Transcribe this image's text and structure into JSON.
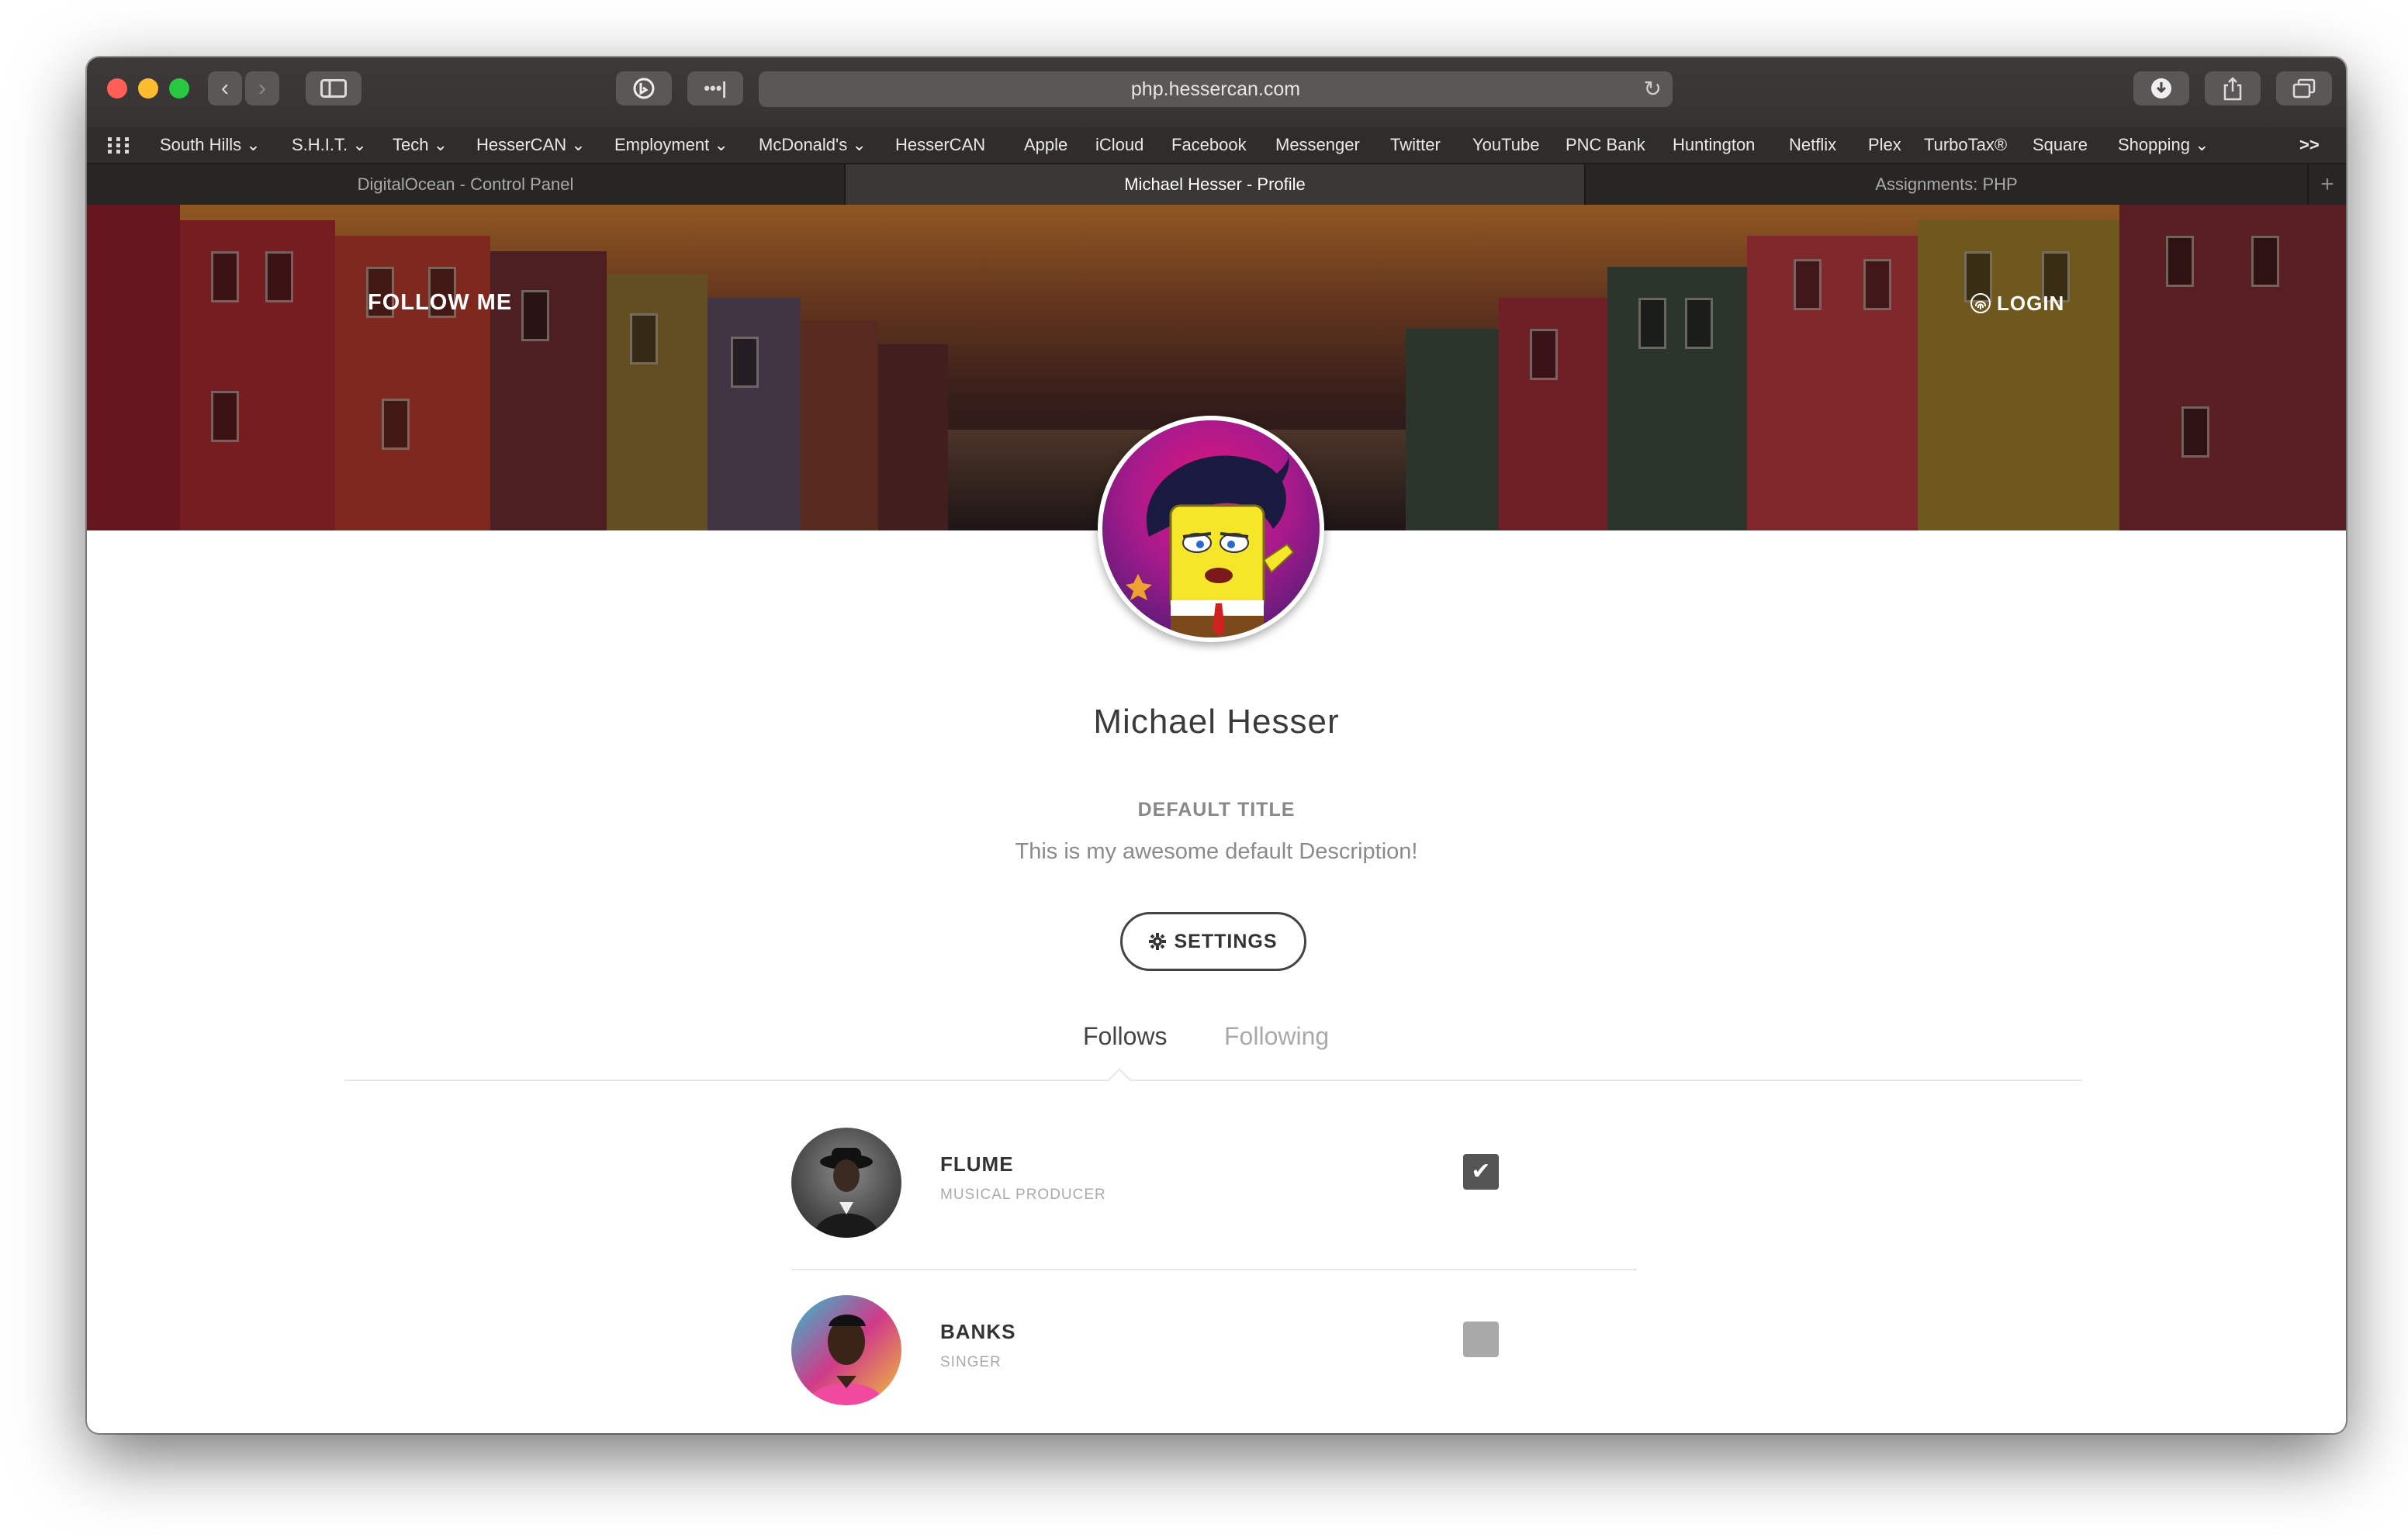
{
  "browser": {
    "url": "php.hessercan.com",
    "bookmarks": [
      {
        "label": "South Hills",
        "dropdown": true
      },
      {
        "label": "S.H.I.T.",
        "dropdown": true
      },
      {
        "label": "Tech",
        "dropdown": true
      },
      {
        "label": "HesserCAN",
        "dropdown": true
      },
      {
        "label": "Employment",
        "dropdown": true
      },
      {
        "label": "McDonald's",
        "dropdown": true
      },
      {
        "label": "HesserCAN",
        "dropdown": false
      },
      {
        "label": "Apple",
        "dropdown": false
      },
      {
        "label": "iCloud",
        "dropdown": false
      },
      {
        "label": "Facebook",
        "dropdown": false
      },
      {
        "label": "Messenger",
        "dropdown": false
      },
      {
        "label": "Twitter",
        "dropdown": false
      },
      {
        "label": "YouTube",
        "dropdown": false
      },
      {
        "label": "PNC Bank",
        "dropdown": false
      },
      {
        "label": "Huntington",
        "dropdown": false
      },
      {
        "label": "Netflix",
        "dropdown": false
      },
      {
        "label": "Plex",
        "dropdown": false
      },
      {
        "label": "TurboTax®",
        "dropdown": false
      },
      {
        "label": "Square",
        "dropdown": false
      },
      {
        "label": "Shopping",
        "dropdown": true
      }
    ],
    "tabs": [
      {
        "label": "DigitalOcean - Control Panel",
        "active": false
      },
      {
        "label": "Michael Hesser - Profile",
        "active": true
      },
      {
        "label": "Assignments: PHP",
        "active": false
      }
    ],
    "more_label": ">>"
  },
  "hero": {
    "follow_me": "FOLLOW ME",
    "login_label": "LOGIN",
    "login_icon": "fingerprint-icon"
  },
  "profile": {
    "name": "Michael Hesser",
    "title": "DEFAULT TITLE",
    "description": "This is my awesome default Description!",
    "settings_label": "SETTINGS",
    "settings_icon": "gear-icon"
  },
  "tabs": {
    "follows": "Follows",
    "following": "Following",
    "active": "Follows"
  },
  "follows": [
    {
      "name": "FLUME",
      "role": "MUSICAL PRODUCER",
      "checked": true
    },
    {
      "name": "BANKS",
      "role": "SINGER",
      "checked": false
    }
  ],
  "colors": {
    "traffic_red": "#ff5f57",
    "traffic_yellow": "#febc2e",
    "traffic_green": "#28c840",
    "active_tab": "#3a3736",
    "checkbox_on": "#555555",
    "checkbox_off": "#a9a9a9"
  }
}
